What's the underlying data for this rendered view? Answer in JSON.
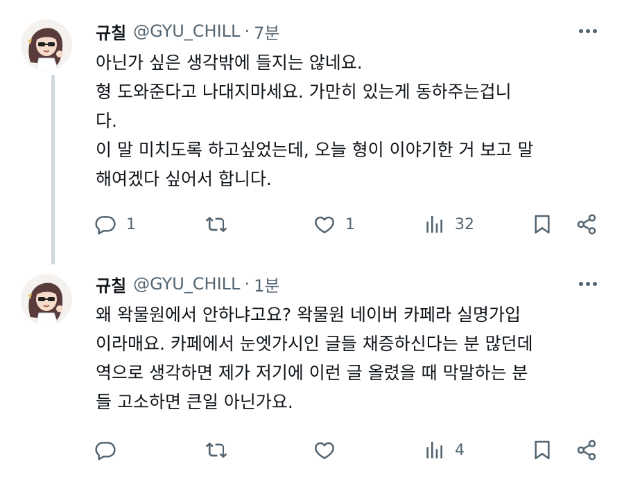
{
  "tweets": [
    {
      "name": "규칠",
      "handle": "@GYU_CHILL",
      "separator": "·",
      "time": "7분",
      "lines": [
        "아닌가 싶은 생각밖에 들지는 않네요.",
        "형 도와준다고 나대지마세요. 가만히 있는게 동하주는겁니",
        "다.",
        "이 말 미치도록 하고싶었는데, 오늘 형이 이야기한 거 보고 말",
        "해여겠다 싶어서 합니다."
      ],
      "reply_count": "1",
      "retweet_count": "",
      "like_count": "1",
      "views_count": "32"
    },
    {
      "name": "규칠",
      "handle": "@GYU_CHILL",
      "separator": "·",
      "time": "1분",
      "lines": [
        "왜 왁물원에서 안하냐고요? 왁물원 네이버 카페라 실명가입",
        "이라매요. 카페에서 눈엣가시인 글들 채증하신다는 분 많던데",
        "역으로 생각하면 제가 저기에 이런 글 올렸을 때 막말하는 분",
        "들 고소하면 큰일 아닌가요."
      ],
      "reply_count": "",
      "retweet_count": "",
      "like_count": "",
      "views_count": "4"
    }
  ],
  "icons": {
    "reply": "reply-icon",
    "retweet": "retweet-icon",
    "like": "heart-icon",
    "views": "views-icon",
    "bookmark": "bookmark-icon",
    "share": "share-icon",
    "more": "more-icon"
  },
  "colors": {
    "text": "#0f1419",
    "secondary": "#536471",
    "thread_line": "#cfd9de"
  }
}
